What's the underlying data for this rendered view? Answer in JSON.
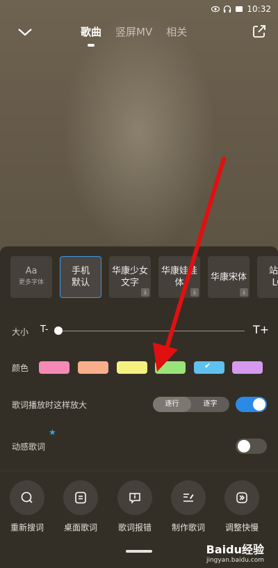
{
  "status": {
    "time": "10:32"
  },
  "nav": {
    "tabs": [
      "歌曲",
      "竖屏MV",
      "相关"
    ],
    "active_tab": 0
  },
  "fonts": {
    "more": {
      "glyph": "Aa",
      "label": "更多字体"
    },
    "items": [
      {
        "label": "手机\n默认",
        "selected": true,
        "download": false
      },
      {
        "label": "华康少女\n文字",
        "selected": false,
        "download": true
      },
      {
        "label": "华康娃娃\n体",
        "selected": false,
        "download": true
      },
      {
        "label": "华康宋体",
        "selected": false,
        "download": true
      },
      {
        "label": "站酷\nLO",
        "selected": false,
        "download": false
      }
    ]
  },
  "size": {
    "label": "大小",
    "minus": "T-",
    "plus": "T+",
    "value": 0
  },
  "colors": {
    "label": "颜色",
    "swatches": [
      "#f58ab6",
      "#f8ae8a",
      "#f6f080",
      "#9be27a",
      "#5ec1ef",
      "#d49af0"
    ],
    "selected_index": 4
  },
  "magnify": {
    "label": "歌词播放时这样放大",
    "options": [
      "逐行",
      "逐字"
    ],
    "selected_option": 0,
    "enabled": true
  },
  "dynamic": {
    "label": "动感歌词",
    "enabled": false
  },
  "actions": [
    {
      "label": "重新搜词",
      "icon": "search-icon"
    },
    {
      "label": "桌面歌词",
      "icon": "desktop-lyrics-icon"
    },
    {
      "label": "歌词报错",
      "icon": "report-icon"
    },
    {
      "label": "制作歌词",
      "icon": "edit-lyrics-icon"
    },
    {
      "label": "调整快慢",
      "icon": "speed-icon"
    }
  ],
  "watermark": {
    "logo": "Baidu经验",
    "url": "jingyan.baidu.com"
  },
  "theme": {
    "accent": "#2b8ae6",
    "arrow": "#e01010"
  }
}
